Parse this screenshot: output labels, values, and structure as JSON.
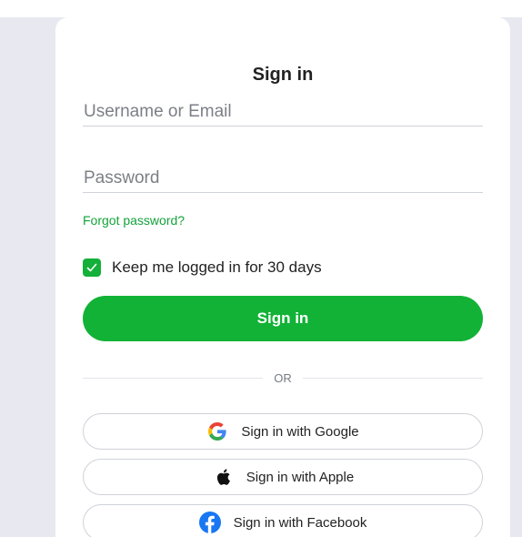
{
  "title": "Sign in",
  "username": {
    "placeholder": "Username or Email",
    "value": ""
  },
  "password": {
    "placeholder": "Password",
    "value": ""
  },
  "forgot_label": "Forgot password?",
  "keep_logged_in": {
    "label": "Keep me logged in for 30 days",
    "checked": true
  },
  "signin_label": "Sign in",
  "divider_label": "OR",
  "social": {
    "google": {
      "label": "Sign in with Google",
      "icon": "google-icon"
    },
    "apple": {
      "label": "Sign in with Apple",
      "icon": "apple-icon"
    },
    "facebook": {
      "label": "Sign in with Facebook",
      "icon": "facebook-icon"
    }
  },
  "colors": {
    "accent": "#12b236",
    "link": "#14a33a",
    "background": "#e8e9f0",
    "facebook": "#1877f2"
  }
}
